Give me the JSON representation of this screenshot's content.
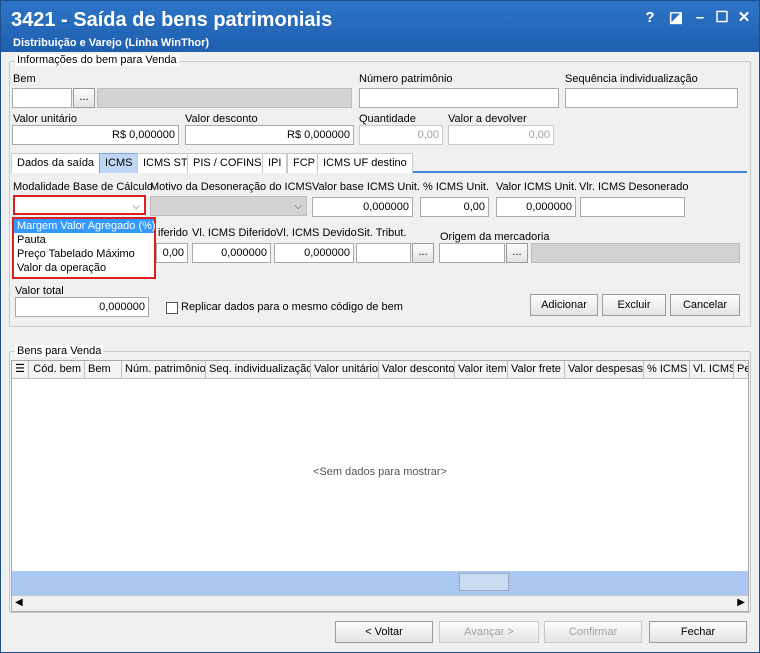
{
  "window": {
    "title": "3421 - Saída de bens patrimoniais",
    "subtitle": "Distribuição e Varejo (Linha WinThor)",
    "help_glyph": "?",
    "restore_glyph": "◪",
    "minimize_glyph": "–",
    "maximize_glyph": "☐",
    "close_glyph": "✕"
  },
  "info_group": {
    "title": "Informações do bem para Venda",
    "bem_label": "Bem",
    "bem_value": "",
    "bem_button": "...",
    "numero_patrimonio_label": "Número patrimônio",
    "numero_patrimonio_value": "",
    "sequencia_label": "Sequência individualização",
    "sequencia_value": "",
    "valor_unitario_label": "Valor unitário",
    "valor_unitario_value": "R$ 0,000000",
    "valor_desconto_label": "Valor desconto",
    "valor_desconto_value": "R$ 0,000000",
    "quantidade_label": "Quantidade",
    "quantidade_value": "0,00",
    "valor_devolver_label": "Valor a devolver",
    "valor_devolver_value": "0,00"
  },
  "tabs": [
    {
      "label": "Dados da saída",
      "active": false
    },
    {
      "label": "ICMS",
      "active": true
    },
    {
      "label": "ICMS ST",
      "active": false
    },
    {
      "label": "PIS / COFINS",
      "active": false
    },
    {
      "label": "IPI",
      "active": false
    },
    {
      "label": "FCP",
      "active": false
    },
    {
      "label": "ICMS UF destino",
      "active": false
    }
  ],
  "icms": {
    "modalidade_label": "Modalidade Base de Cálculo",
    "modalidade_value": "",
    "modalidade_options": [
      "Margem Valor Agregado (%)",
      "Pauta",
      "Preço Tabelado Máximo",
      "Valor da operação"
    ],
    "motivo_label": "Motivo da Desoneração do ICMS",
    "valor_base_label": "Valor base ICMS Unit.",
    "valor_base_value": "0,000000",
    "pct_icms_label": "% ICMS Unit.",
    "pct_icms_value": "0,00",
    "valor_icms_label": "Valor ICMS Unit.",
    "valor_icms_value": "0,000000",
    "vlr_desonerado_label": "Vlr. ICMS Desonerado",
    "vlr_desonerado_value": "",
    "diferido_label": "iferido",
    "diferido_value": "0,00",
    "vl_diferido_label": "Vl. ICMS Diferido",
    "vl_diferido_value": "0,000000",
    "vl_devido_label": "Vl. ICMS Devido",
    "vl_devido_value": "0,000000",
    "sit_tribut_label": "Sit. Tribut.",
    "sit_tribut_value": "",
    "origem_label": "Origem da mercadoria",
    "origem_value": "",
    "browse": "..."
  },
  "totals": {
    "valor_total_label": "Valor total",
    "valor_total_value": "0,000000",
    "replicar_label": "Replicar dados para o mesmo código de bem",
    "adicionar_label": "Adicionar",
    "excluir_label": "Excluir",
    "cancelar_label": "Cancelar"
  },
  "grid": {
    "title": "Bens para Venda",
    "columns": [
      "Cód. bem",
      "Bem",
      "Núm. patrimônio",
      "Seq. individualização",
      "Valor unitário",
      "Valor desconto",
      "Valor item",
      "Valor frete",
      "Valor despesas",
      "% ICMS",
      "Vl. ICMS",
      "Pe"
    ],
    "empty_text": "<Sem dados para mostrar>"
  },
  "nav": {
    "voltar_label": "< Voltar",
    "avancar_label": "Avançar >",
    "confirmar_label": "Confirmar",
    "fechar_label": "Fechar"
  }
}
